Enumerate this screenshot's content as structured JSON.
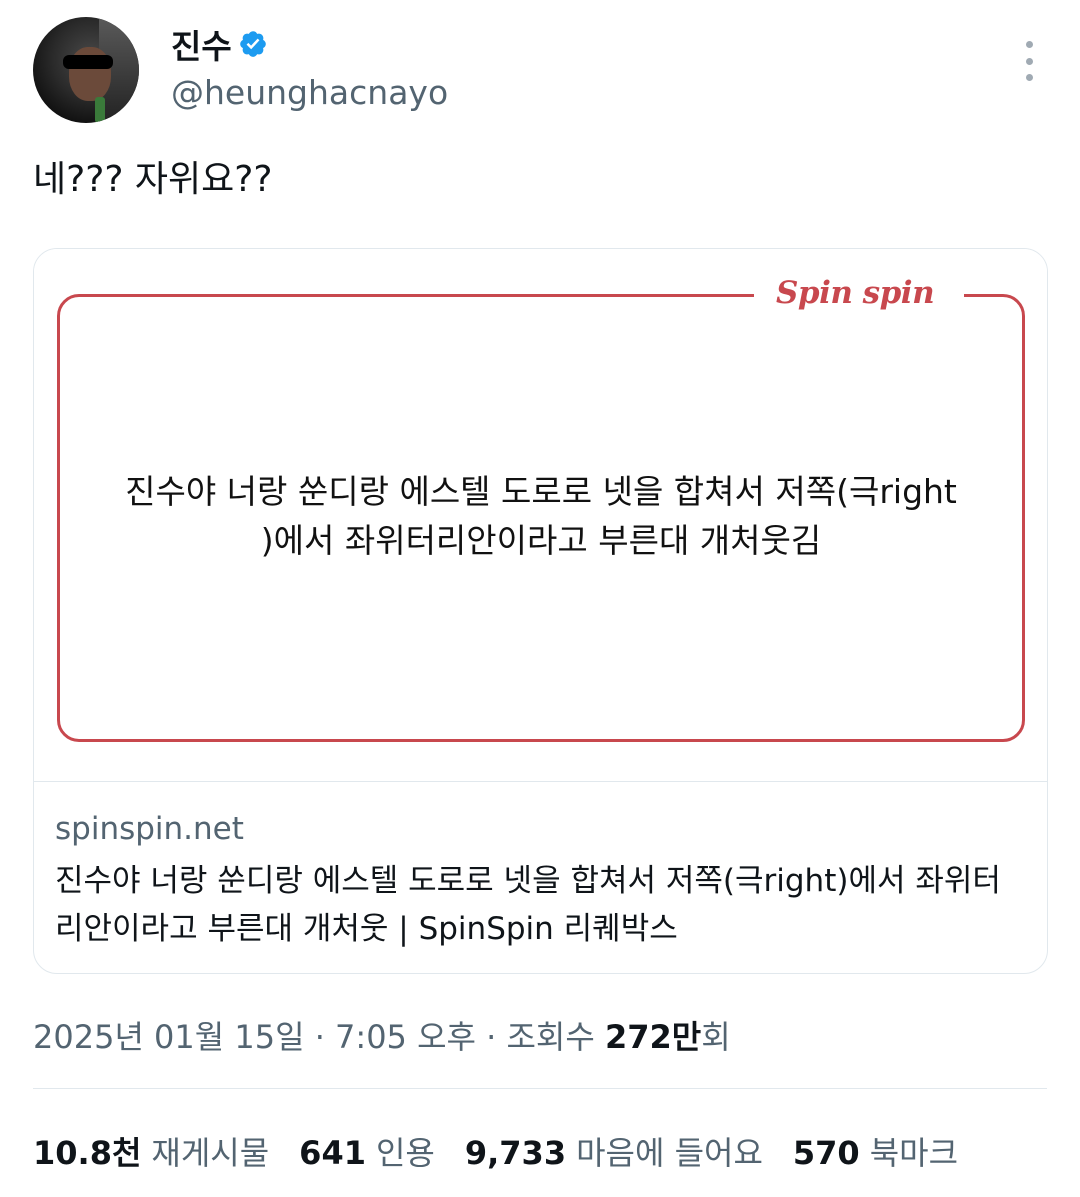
{
  "author": {
    "display_name": "진수",
    "handle": "@heunghacnayo",
    "verified": true
  },
  "tweet": {
    "text": "네??? 자위요??"
  },
  "card": {
    "image": {
      "logo": "Spin spin",
      "quote_line1": "진수야 너랑 쑨디랑 에스텔 도로로 넷을 합쳐서 저쪽(극right",
      "quote_line2": ")에서 좌위터리안이라고 부른대 개처웃김"
    },
    "domain": "spinspin.net",
    "title": "진수야 너랑 쑨디랑 에스텔 도로로 넷을 합쳐서 저쪽(극right)에서 좌위터리안이라고 부른대 개처웃 | SpinSpin 리퀘박스"
  },
  "meta": {
    "datetime": "2025년 01월 15일 · 7:05 오후 · 조회수 ",
    "views_number": "272만",
    "views_suffix": "회"
  },
  "stats": [
    {
      "number": "10.8천",
      "label": "재게시물"
    },
    {
      "number": "641",
      "label": "인용"
    },
    {
      "number": "9,733",
      "label": "마음에 들어요"
    },
    {
      "number": "570",
      "label": "북마크"
    }
  ],
  "colors": {
    "accent_red": "#c8484e",
    "verified_blue": "#1d9bf0",
    "secondary_text": "#536471"
  },
  "icons": {
    "verified": "verified-badge-icon",
    "more": "more-options-icon"
  }
}
